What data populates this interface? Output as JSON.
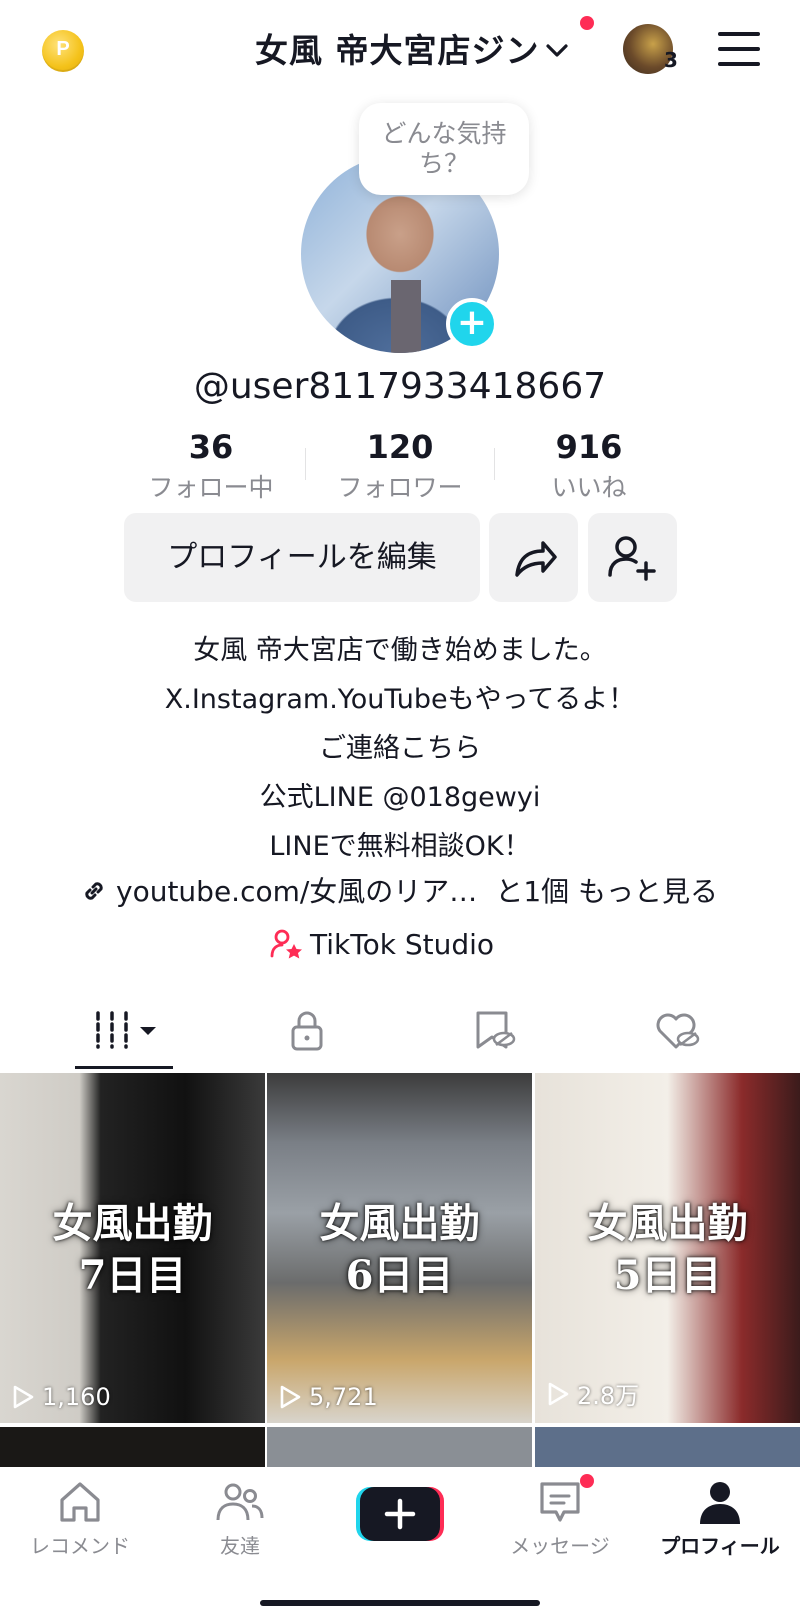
{
  "header": {
    "coin_letter": "P",
    "account_title": "女風 帝大宮店ジン",
    "account_chevron": "⌄",
    "switch_count": "3",
    "menu_icon": "hamburger-icon"
  },
  "profile": {
    "mood_prompt": "どんな気持ち？",
    "username": "@user8117933418667",
    "stats": [
      {
        "value": "36",
        "label": "フォロー中"
      },
      {
        "value": "120",
        "label": "フォロワー"
      },
      {
        "value": "916",
        "label": "いいね"
      }
    ],
    "edit_label": "プロフィールを編集",
    "bio": [
      "女風 帝大宮店で働き始めました。",
      "X.Instagram.YouTubeもやってるよ！",
      "ご連絡こちら",
      "公式LINE @018gewyi",
      "LINEで無料相談OK！"
    ],
    "link_text": "youtube.com/女風のリア…",
    "link_more": "と1個 もっと見る",
    "studio_label": "TikTok Studio"
  },
  "videos": [
    {
      "caption_line1": "女風出勤",
      "caption_line2": "7日目",
      "views": "1,160"
    },
    {
      "caption_line1": "女風出勤",
      "caption_line2": "6日目",
      "views": "5,721"
    },
    {
      "caption_line1": "女風出勤",
      "caption_line2": "5日目",
      "views": "2.8万"
    }
  ],
  "nav": {
    "home": "レコメンド",
    "friends": "友達",
    "messages": "メッセージ",
    "profile": "プロフィール"
  },
  "colors": {
    "accent": "#fe2c55",
    "cyan": "#20d5ec",
    "text": "#161823",
    "muted": "#8a8b91"
  }
}
